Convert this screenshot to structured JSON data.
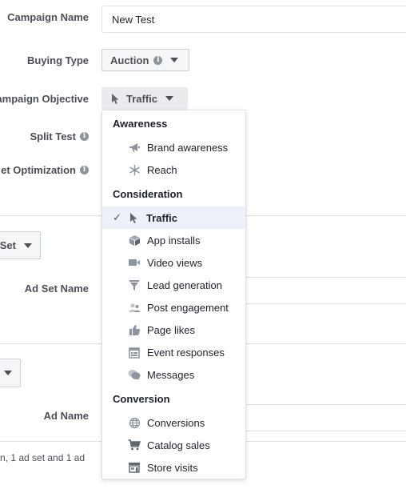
{
  "campaign": {
    "name_label": "Campaign Name",
    "name_value": "New Test",
    "buying_type_label": "Buying Type",
    "buying_type_value": "Auction",
    "objective_label": "ampaign Objective",
    "objective_value": "Traffic",
    "split_test_label": "Split Test",
    "budget_label": "et Optimization"
  },
  "adset": {
    "button_label": "Set",
    "name_label": "Ad Set Name"
  },
  "ad": {
    "name_label": "Ad Name",
    "footer_text": "n, 1 ad set and 1 ad"
  },
  "dropdown": {
    "sections": [
      {
        "title": "Awareness",
        "items": [
          {
            "label": "Brand awareness",
            "icon": "megaphone-icon"
          },
          {
            "label": "Reach",
            "icon": "reach-icon"
          }
        ]
      },
      {
        "title": "Consideration",
        "items": [
          {
            "label": "Traffic",
            "icon": "cursor-icon",
            "selected": true
          },
          {
            "label": "App installs",
            "icon": "box-icon"
          },
          {
            "label": "Video views",
            "icon": "video-camera-icon"
          },
          {
            "label": "Lead generation",
            "icon": "funnel-icon"
          },
          {
            "label": "Post engagement",
            "icon": "people-icon"
          },
          {
            "label": "Page likes",
            "icon": "thumbs-up-icon"
          },
          {
            "label": "Event responses",
            "icon": "event-icon"
          },
          {
            "label": "Messages",
            "icon": "chat-bubbles-icon"
          }
        ]
      },
      {
        "title": "Conversion",
        "items": [
          {
            "label": "Conversions",
            "icon": "globe-icon"
          },
          {
            "label": "Catalog sales",
            "icon": "cart-icon"
          },
          {
            "label": "Store visits",
            "icon": "store-icon"
          }
        ]
      }
    ]
  },
  "colors": {
    "selected_bg": "#edf2fa",
    "border": "#dddfe2",
    "label_text": "#4b4f56"
  }
}
